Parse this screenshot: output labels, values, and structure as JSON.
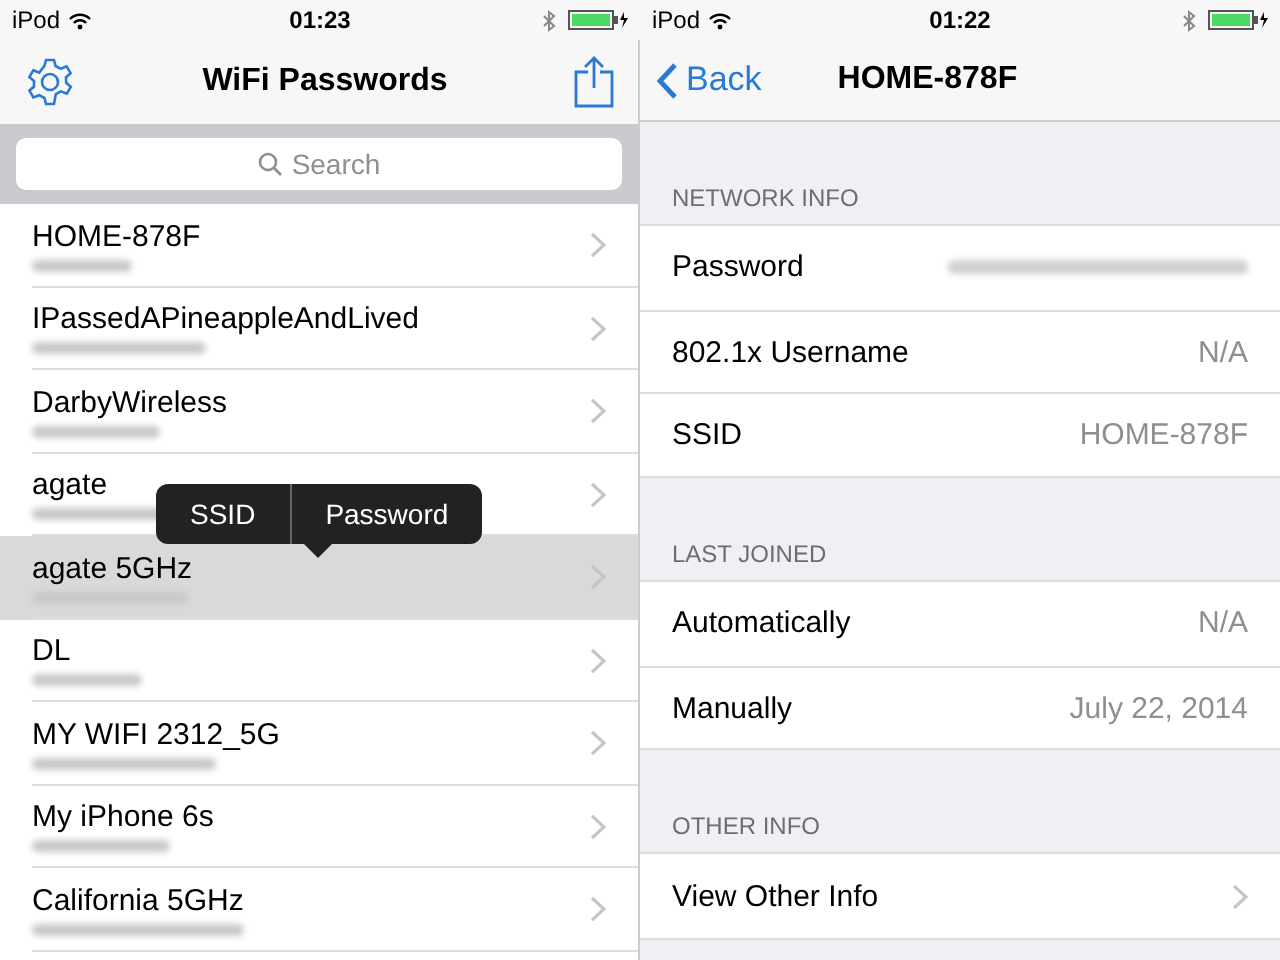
{
  "left": {
    "status_bar": {
      "carrier": "iPod",
      "time": "01:23"
    },
    "nav": {
      "title": "WiFi Passwords"
    },
    "search": {
      "placeholder": "Search"
    },
    "networks": [
      {
        "name": "HOME-878F",
        "selected": false
      },
      {
        "name": "IPassedAPineappleAndLived",
        "selected": false
      },
      {
        "name": "DarbyWireless",
        "selected": false
      },
      {
        "name": "agate",
        "selected": false
      },
      {
        "name": "agate 5GHz",
        "selected": true
      },
      {
        "name": "DL",
        "selected": false
      },
      {
        "name": "MY WIFI 2312_5G",
        "selected": false
      },
      {
        "name": "My iPhone 6s",
        "selected": false
      },
      {
        "name": "California 5GHz",
        "selected": false
      }
    ],
    "context_menu": {
      "items": [
        "SSID",
        "Password"
      ]
    }
  },
  "right": {
    "status_bar": {
      "carrier": "iPod",
      "time": "01:22"
    },
    "nav": {
      "back": "Back",
      "title": "HOME-878F"
    },
    "sections": [
      {
        "header": "NETWORK INFO",
        "rows": [
          {
            "kind": "hidden",
            "label": "Password"
          },
          {
            "kind": "value",
            "label": "802.1x Username",
            "value": "N/A"
          },
          {
            "kind": "value",
            "label": "SSID",
            "value": "HOME-878F"
          }
        ]
      },
      {
        "header": "LAST JOINED",
        "rows": [
          {
            "kind": "value",
            "label": "Automatically",
            "value": "N/A"
          },
          {
            "kind": "value",
            "label": "Manually",
            "value": "July 22, 2014"
          }
        ]
      },
      {
        "header": "OTHER INFO",
        "rows": [
          {
            "kind": "link",
            "label": "View Other Info"
          }
        ]
      }
    ]
  }
}
